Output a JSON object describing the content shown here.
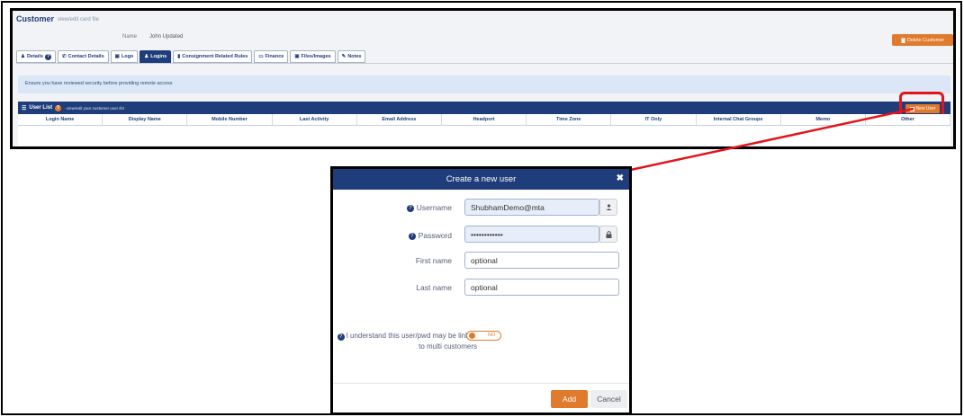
{
  "customer": {
    "title": "Customer",
    "subtitle": "view/edit card file",
    "name_label": "Name",
    "name_value": "John Updated",
    "delete_button": "Delete Customer"
  },
  "tabs": [
    {
      "label": "Details",
      "icon": "user-icon",
      "active": false
    },
    {
      "label": "Contact Details",
      "icon": "phone-icon",
      "active": false
    },
    {
      "label": "Logo",
      "icon": "image-icon",
      "active": false
    },
    {
      "label": "Logins",
      "icon": "users-icon",
      "active": true
    },
    {
      "label": "Consignment Related Rules",
      "icon": "file-icon",
      "active": false
    },
    {
      "label": "Finance",
      "icon": "folder-icon",
      "active": false
    },
    {
      "label": "Files/Images",
      "icon": "image-file-icon",
      "active": false
    },
    {
      "label": "Notes",
      "icon": "pencil-icon",
      "active": false
    }
  ],
  "alert_text": "Ensure you have reviewed security before providing remote access",
  "user_list": {
    "title": "User List",
    "subtitle": "- view/edit your customer user list",
    "new_user_button": "New User",
    "columns": [
      "Login Name",
      "Display Name",
      "Mobile Number",
      "Last Activity",
      "Email Address",
      "Headport",
      "Time Zone",
      "IT Only",
      "Internal Chat Groups",
      "Memo",
      "Other"
    ]
  },
  "modal": {
    "title": "Create a new user",
    "username_label": "Username",
    "username_value": "ShubhamDemo@mta",
    "password_label": "Password",
    "password_value": "••••••••••••",
    "first_name_label": "First name",
    "first_name_placeholder": "optional",
    "last_name_label": "Last name",
    "last_name_placeholder": "optional",
    "consent_label": "I understand this user/pwd may be linked to multi customers",
    "toggle_text": "NO",
    "add_button": "Add",
    "cancel_button": "Cancel"
  },
  "colors": {
    "navy": "#1f3d7a",
    "orange": "#e07b2e",
    "highlight_red": "#e3141b"
  }
}
